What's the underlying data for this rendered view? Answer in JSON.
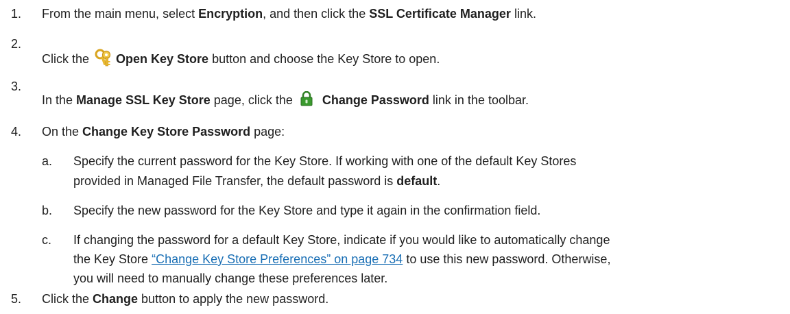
{
  "steps": [
    {
      "num": "1.",
      "t1": "From the main menu, select ",
      "b1": "Encryption",
      "t2": ", and then click the ",
      "b2": "SSL Certificate Manager",
      "t3": " link."
    },
    {
      "num": "2.",
      "t1": "Click the ",
      "icon": "key-ring-icon",
      "b1": "Open Key Store",
      "t2": " button and choose the Key Store to open."
    },
    {
      "num": "3.",
      "t1": "In the ",
      "b1": "Manage SSL Key Store",
      "t2": " page, click the ",
      "icon": "lock-icon",
      "b2": "Change Password",
      "t3": " link in the toolbar."
    },
    {
      "num": "4.",
      "t1": "On the ",
      "b1": "Change Key Store Password",
      "t2": " page:",
      "substeps": [
        {
          "num": "a.",
          "line1": "Specify the current password for the Key Store. If working with one of the default Key Stores",
          "line2a": "provided in Managed File Transfer, the default password is ",
          "line2b": "default",
          "line2c": "."
        },
        {
          "num": "b.",
          "line1": "Specify the new password for the Key Store and type it again in the confirmation field."
        },
        {
          "num": "c.",
          "line1": "If changing the password for a default Key Store, indicate if you would like to automatically change",
          "line2a": "the Key Store ",
          "link": "“Change Key Store Preferences” on page 734",
          "line2c": " to use this new password. Otherwise,",
          "line3": "you will need to manually change these preferences later."
        }
      ]
    },
    {
      "num": "5.",
      "t1": "Click the ",
      "b1": "Change",
      "t2": " button to apply the new password."
    }
  ],
  "colors": {
    "text": "#1f1f1f",
    "link": "#1a6fb5",
    "lock": "#3a9a2e",
    "key": "#e2b32a"
  }
}
